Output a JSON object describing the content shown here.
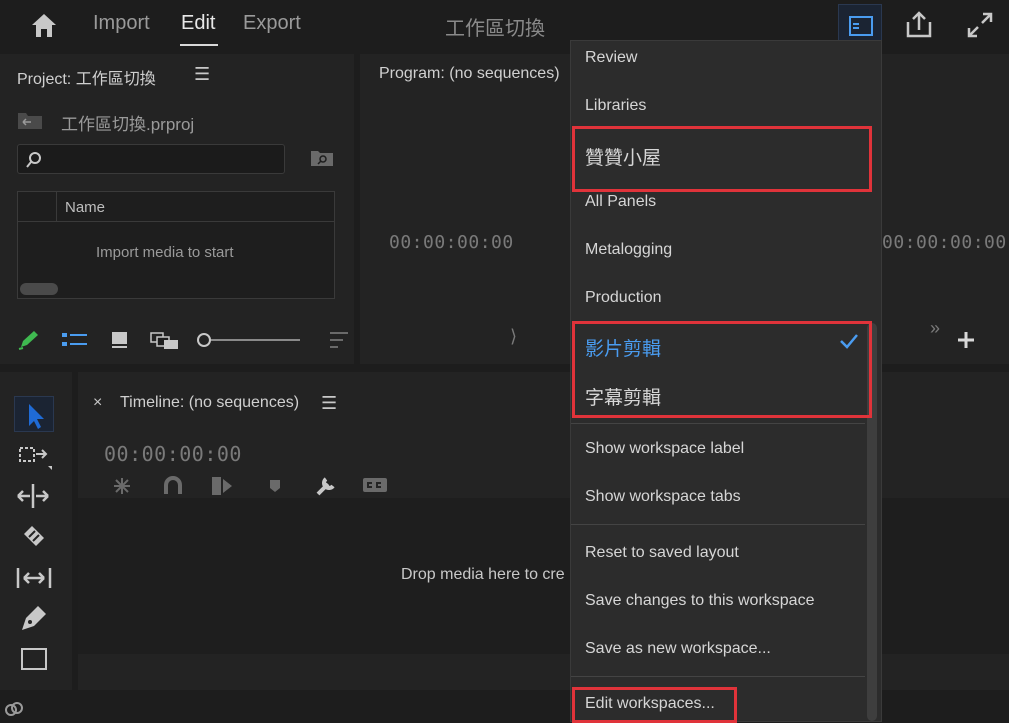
{
  "header": {
    "tabs": [
      {
        "label": "Import"
      },
      {
        "label": "Edit"
      },
      {
        "label": "Export"
      }
    ],
    "title": "工作區切換"
  },
  "project": {
    "title": "Project: 工作區切換",
    "file_name": "工作區切換.prproj",
    "search_placeholder": "",
    "column_name": "Name",
    "empty_message": "Import media to start"
  },
  "program": {
    "title": "Program: (no sequences)",
    "timecode_left": "00:00:00:00",
    "timecode_right": "00:00:00:00"
  },
  "timeline": {
    "title": "Timeline: (no sequences)",
    "timecode": "00:00:00:00",
    "drop_message": "Drop media here to cre"
  },
  "workspace_menu": {
    "items": [
      {
        "label": "Review"
      },
      {
        "label": "Libraries"
      },
      {
        "label": "贊贊小屋"
      },
      {
        "label": "All Panels"
      },
      {
        "label": "Metalogging"
      },
      {
        "label": "Production"
      },
      {
        "label": "影片剪輯",
        "checked": true
      },
      {
        "label": "字幕剪輯"
      }
    ],
    "show_label": "Show workspace label",
    "show_tabs": "Show workspace tabs",
    "reset": "Reset to saved layout",
    "save_changes": "Save changes to this workspace",
    "save_new": "Save as new workspace...",
    "edit": "Edit workspaces..."
  },
  "colors": {
    "accent": "#4a9cf0",
    "highlight_box": "#e0333a",
    "tool_active": "#1f6bd6",
    "pencil_icon": "#3fb950"
  }
}
